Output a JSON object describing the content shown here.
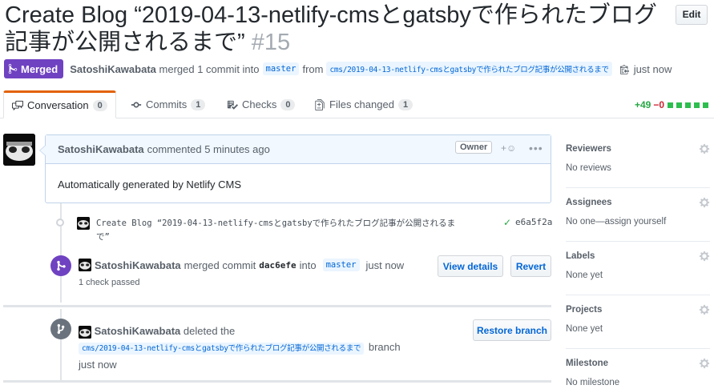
{
  "header": {
    "title": "Create Blog “2019-04-13-netlify-cmsとgatsbyで作られたブログ記事が公開されるまで”",
    "number": "#15",
    "edit_label": "Edit"
  },
  "meta": {
    "status": "Merged",
    "author": "SatoshiKawabata",
    "action": "merged 1 commit into",
    "base_branch": "master",
    "from_text": "from",
    "head_branch": "cms/2019-04-13-netlify-cmsとgatsbyで作られたブログ記事が公開されるまで",
    "time": "just now"
  },
  "tabs": [
    {
      "label": "Conversation",
      "count": "0"
    },
    {
      "label": "Commits",
      "count": "1"
    },
    {
      "label": "Checks",
      "count": "0"
    },
    {
      "label": "Files changed",
      "count": "1"
    }
  ],
  "diffstat": {
    "additions": "+49",
    "deletions": "−0"
  },
  "comment": {
    "author": "SatoshiKawabata",
    "action": "commented 5 minutes ago",
    "role": "Owner",
    "body": "Automatically generated by Netlify CMS"
  },
  "commit": {
    "message": "Create Blog “2019-04-13-netlify-cmsとgatsbyで作られたブログ記事が公開されるまで”",
    "sha": "e6a5f2a"
  },
  "merge_event": {
    "author": "SatoshiKawabata",
    "action": "merged commit",
    "sha": "dac6efe",
    "into": "into",
    "branch": "master",
    "time": "just now",
    "checks": "1 check passed",
    "view_details": "View details",
    "revert": "Revert"
  },
  "delete_event": {
    "author": "SatoshiKawabata",
    "action": "deleted the",
    "branch": "cms/2019-04-13-netlify-cmsとgatsbyで作られたブログ記事が公開されるまで",
    "branch_word": "branch",
    "time": "just now",
    "restore": "Restore branch"
  },
  "sidebar": [
    {
      "title": "Reviewers",
      "value": "No reviews"
    },
    {
      "title": "Assignees",
      "value": "No one—assign yourself"
    },
    {
      "title": "Labels",
      "value": "None yet"
    },
    {
      "title": "Projects",
      "value": "None yet"
    },
    {
      "title": "Milestone",
      "value": "No milestone"
    }
  ],
  "colors": {
    "merged": "#6f42c1",
    "link": "#0366d6",
    "green": "#28a745",
    "red": "#cb2431"
  }
}
